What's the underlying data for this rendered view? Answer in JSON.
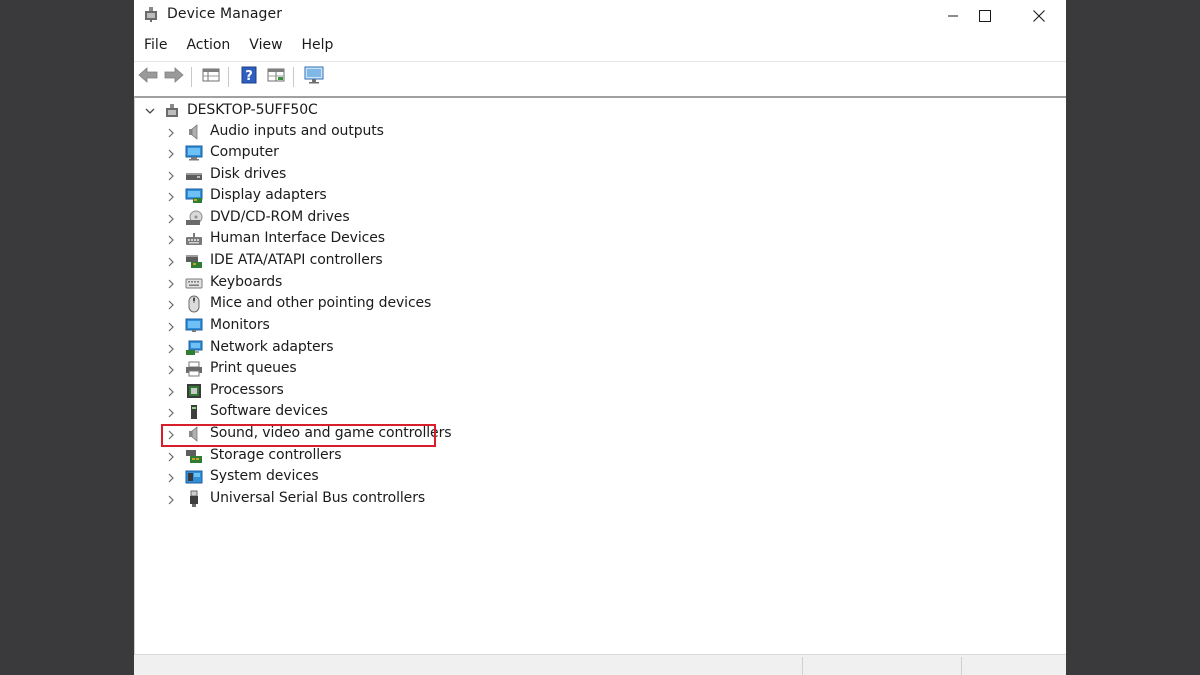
{
  "window": {
    "title": "Device Manager",
    "icon": "device-manager-icon"
  },
  "menu": [
    "File",
    "Action",
    "View",
    "Help"
  ],
  "toolbar": {
    "buttons": [
      "back-arrow-icon",
      "forward-arrow-icon",
      "properties-grid-icon",
      "help-icon",
      "details-grid-icon",
      "monitor-scan-icon"
    ]
  },
  "tree": {
    "root": "DESKTOP-5UFF50C",
    "items": [
      {
        "label": "Audio inputs and outputs",
        "icon": "speaker-icon"
      },
      {
        "label": "Computer",
        "icon": "computer-icon"
      },
      {
        "label": "Disk drives",
        "icon": "disk-drive-icon"
      },
      {
        "label": "Display adapters",
        "icon": "display-adapter-icon"
      },
      {
        "label": "DVD/CD-ROM drives",
        "icon": "dvd-drive-icon"
      },
      {
        "label": "Human Interface Devices",
        "icon": "hid-icon"
      },
      {
        "label": "IDE ATA/ATAPI controllers",
        "icon": "ide-controller-icon"
      },
      {
        "label": "Keyboards",
        "icon": "keyboard-icon"
      },
      {
        "label": "Mice and other pointing devices",
        "icon": "mouse-icon"
      },
      {
        "label": "Monitors",
        "icon": "monitor-icon"
      },
      {
        "label": "Network adapters",
        "icon": "network-adapter-icon"
      },
      {
        "label": "Print queues",
        "icon": "printer-icon"
      },
      {
        "label": "Processors",
        "icon": "processor-icon"
      },
      {
        "label": "Software devices",
        "icon": "software-device-icon"
      },
      {
        "label": "Sound, video and game controllers",
        "icon": "speaker-icon"
      },
      {
        "label": "Storage controllers",
        "icon": "storage-controller-icon"
      },
      {
        "label": "System devices",
        "icon": "system-device-icon"
      },
      {
        "label": "Universal Serial Bus controllers",
        "icon": "usb-icon"
      }
    ]
  },
  "highlight": {
    "item": "Sound, video and game controllers",
    "color": "#d81e2a"
  },
  "colors": {
    "background": "#3a3a3c",
    "window": "#ffffff",
    "text": "#1b1b1b"
  }
}
